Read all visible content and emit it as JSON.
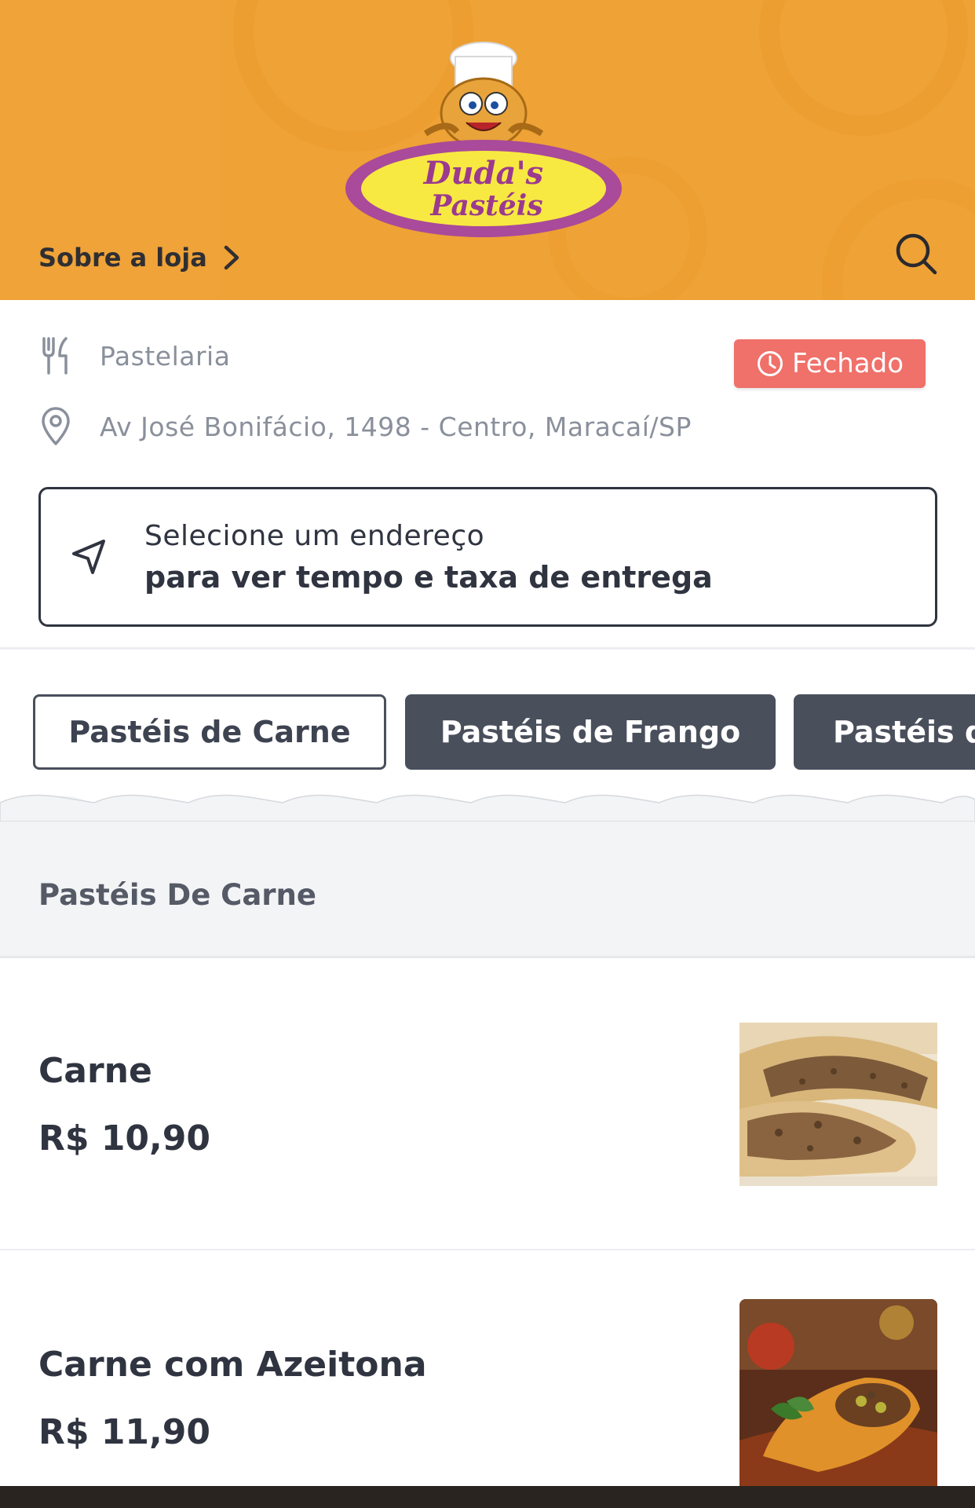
{
  "header": {
    "logo_text_line1": "Duda's",
    "logo_text_line2": "Pastéis",
    "about_label": "Sobre a loja",
    "background_color": "#f0a338"
  },
  "store": {
    "category": "Pastelaria",
    "address": "Av José Bonifácio, 1498 - Centro, Maracaí/SP",
    "status": "Fechado",
    "status_color": "#f0706a"
  },
  "delivery": {
    "line1": "Selecione um endereço",
    "line2": "para ver tempo e taxa de entrega"
  },
  "tabs": [
    {
      "label": "Pastéis de Carne",
      "active": true
    },
    {
      "label": "Pastéis de Frango",
      "active": false
    },
    {
      "label": "Pastéis de",
      "active": false
    }
  ],
  "section": {
    "title": "Pastéis De Carne"
  },
  "products": [
    {
      "name": "Carne",
      "price": "R$ 10,90"
    },
    {
      "name": "Carne com Azeitona",
      "price": "R$ 11,90"
    }
  ],
  "icons": {
    "category": "utensils-icon",
    "location": "map-pin-icon",
    "status": "clock-icon",
    "delivery": "navigation-arrow-icon",
    "search": "search-icon",
    "about": "chevron-right-icon"
  }
}
